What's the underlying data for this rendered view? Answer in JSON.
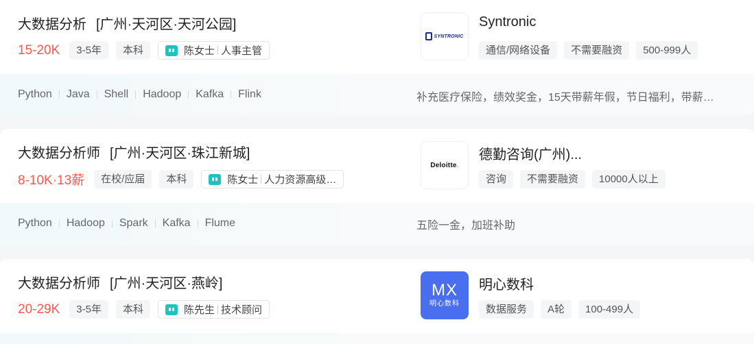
{
  "jobs": [
    {
      "title": "大数据分析",
      "location": "[广州·天河区·天河公园]",
      "salary": "15-20K",
      "tags": [
        "3-5年",
        "本科"
      ],
      "recruiter": {
        "name": "陈女士",
        "title": "人事主管"
      },
      "company": {
        "name": "Syntronic",
        "logo_text": "SYNTRONIC",
        "tags": [
          "通信/网络设备",
          "不需要融资",
          "500-999人"
        ]
      },
      "skills": [
        "Python",
        "Java",
        "Shell",
        "Hadoop",
        "Kafka",
        "Flink"
      ],
      "welfare": "补充医疗保险，绩效奖金，15天带薪年假，节日福利，带薪…"
    },
    {
      "title": "大数据分析师",
      "location": "[广州·天河区·珠江新城]",
      "salary": "8-10K·13薪",
      "tags": [
        "在校/应届",
        "本科"
      ],
      "recruiter": {
        "name": "陈女士",
        "title": "人力资源高级…"
      },
      "company": {
        "name": "德勤咨询(广州)...",
        "logo_text": "Deloitte",
        "logo_dot": ".",
        "tags": [
          "咨询",
          "不需要融资",
          "10000人以上"
        ]
      },
      "skills": [
        "Python",
        "Hadoop",
        "Spark",
        "Kafka",
        "Flume"
      ],
      "welfare": "五险一金，加班补助"
    },
    {
      "title": "大数据分析师",
      "location": "[广州·天河区·燕岭]",
      "salary": "20-29K",
      "tags": [
        "3-5年",
        "本科"
      ],
      "recruiter": {
        "name": "陈先生",
        "title": "技术顾问"
      },
      "company": {
        "name": "明心数科",
        "logo_text": "MX",
        "logo_subtext": "明心数科",
        "tags": [
          "数据服务",
          "A轮",
          "100-499人"
        ]
      },
      "skills": [],
      "welfare": ""
    }
  ],
  "colors": {
    "salary": "#fe574a",
    "chat_icon": "#1dc4bf",
    "mx_logo": "#4a6ef0"
  }
}
